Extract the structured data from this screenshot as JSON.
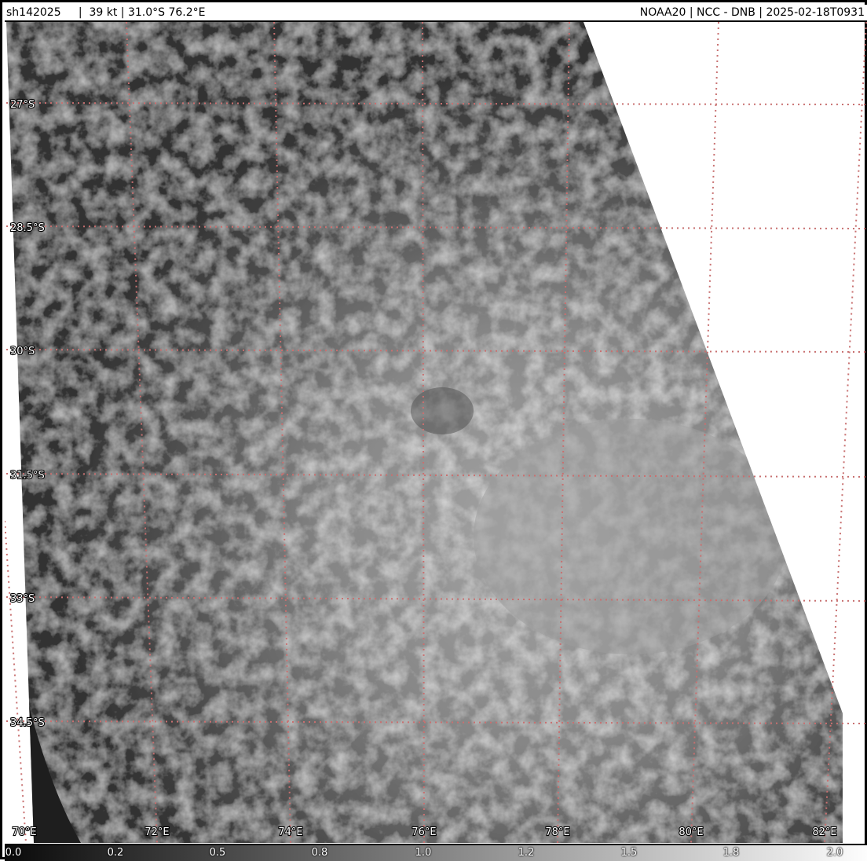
{
  "header": {
    "left": "sh142025     |  39 kt | 31.0°S 76.2°E",
    "right": "NOAA20 | NCC - DNB | 2025-02-18T0931"
  },
  "map": {
    "lat_labels": [
      "27°S",
      "28.5°S",
      "30°S",
      "31.5°S",
      "33°S",
      "34.5°S"
    ],
    "lon_labels": [
      "70°E",
      "72°E",
      "74°E",
      "76°E",
      "78°E",
      "80°E",
      "82°E"
    ],
    "grid_color": "#c87070"
  },
  "colorbar": {
    "ticks": [
      "0.0",
      "0.2",
      "0.5",
      "0.8",
      "1.0",
      "1.2",
      "1.5",
      "1.8",
      "2.0"
    ]
  }
}
